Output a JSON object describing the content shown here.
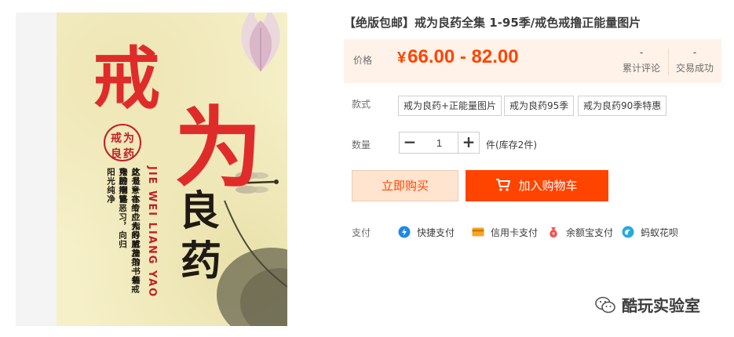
{
  "product": {
    "title": "【绝版包邮】戒为良药全集 1-95季/戒色戒撸正能量图片"
  },
  "cover": {
    "big_char_1": "戒",
    "big_char_2": "为",
    "char_3": "良",
    "char_4": "药",
    "seal_chars": [
      "戒",
      "为",
      "良",
      "药"
    ],
    "pinyin": "JIE WEI LIANG YAO",
    "vertical_line_1": "这是一本专业指导戒撸的书籍",
    "vertical_line_2": "此书意在给广大的朋友指一条戒撸的明路",
    "vertical_line_3": "克服撸管恶习，向归阳光纯净"
  },
  "price": {
    "label": "价格",
    "currency": "¥",
    "value": "66.00 - 82.00"
  },
  "stats": {
    "reviews_count": "-",
    "reviews_label": "累计评论",
    "sales_count": "-",
    "sales_label": "交易成功"
  },
  "style": {
    "label": "款式",
    "options": [
      "戒为良药+正能量图片",
      "戒为良药95季",
      "戒为良药90季特惠"
    ]
  },
  "quantity": {
    "label": "数量",
    "minus": "−",
    "plus": "+",
    "value": "1",
    "stock_text": "件(库存2件)"
  },
  "buttons": {
    "buy_now": "立即购买",
    "add_to_cart": "加入购物车"
  },
  "payment": {
    "label": "支付",
    "methods": [
      "快捷支付",
      "信用卡支付",
      "余额宝支付",
      "蚂蚁花呗"
    ]
  },
  "watermark": {
    "text": "酷玩实验室"
  },
  "colors": {
    "accent": "#ff4400",
    "price_bg": "#fff2e8",
    "cover_red": "#e02b2b"
  }
}
